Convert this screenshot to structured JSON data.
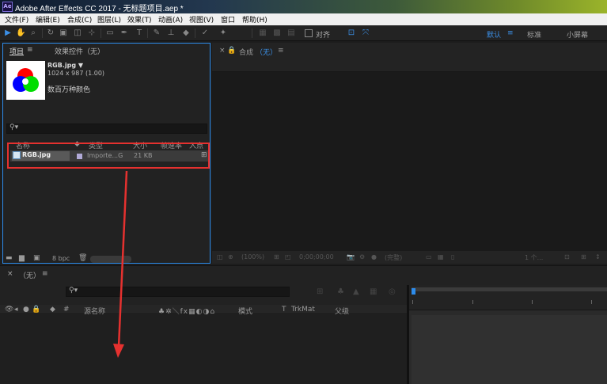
{
  "window": {
    "title": "Adobe After Effects CC 2017 - 无标题项目.aep *",
    "app_icon": "Ae"
  },
  "menu": [
    "文件(F)",
    "编辑(E)",
    "合成(C)",
    "图层(L)",
    "效果(T)",
    "动画(A)",
    "视图(V)",
    "窗口",
    "帮助(H)"
  ],
  "toolbar": {
    "align_label": "对齐"
  },
  "workspaces": {
    "default": "默认",
    "standard": "标准",
    "small_screen": "小屏幕"
  },
  "project_panel": {
    "tab_project": "项目",
    "tab_effects": "效果控件（无）",
    "selected_name": "RGB.jpg ▼",
    "selected_dims": "1024 x 987 (1.00)",
    "selected_colors": "数百万种颜色",
    "columns": [
      "名称",
      "类型",
      "大小",
      "帧速率",
      "入点"
    ],
    "files": [
      {
        "name": "RGB.jpg",
        "type": "Importe...G",
        "size": "21 KB"
      }
    ],
    "bpc": "8 bpc"
  },
  "comp_panel": {
    "tab_label": "合成",
    "tab_value": "（无）",
    "zoom": "(100%)",
    "timecode": "0;00;00;00",
    "resolution": "(完整)",
    "view": "1 个..."
  },
  "timeline": {
    "tab_label": "（无）",
    "columns": {
      "source_name": "源名称",
      "mode": "模式",
      "t": "T",
      "trkmat": "TrkMat",
      "parent": "父级",
      "hash": "#"
    }
  },
  "colors": {
    "accent": "#2d8ceb",
    "annotation_red": "#e5312f"
  }
}
